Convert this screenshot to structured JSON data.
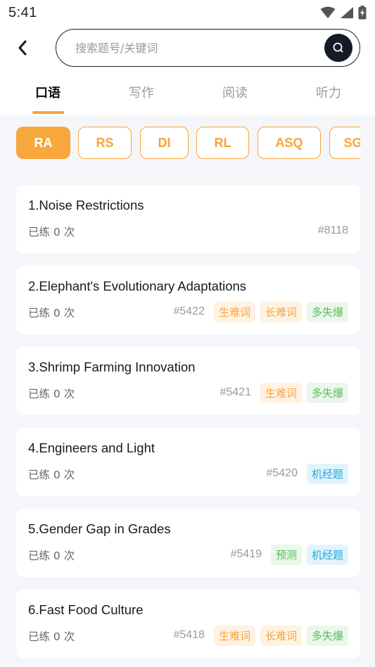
{
  "status_bar": {
    "time": "5:41"
  },
  "search": {
    "placeholder": "搜索题号/关键词",
    "value": ""
  },
  "tabs": [
    {
      "label": "口语",
      "active": true
    },
    {
      "label": "写作",
      "active": false
    },
    {
      "label": "阅读",
      "active": false
    },
    {
      "label": "听力",
      "active": false
    }
  ],
  "chips": [
    {
      "label": "RA",
      "active": true
    },
    {
      "label": "RS",
      "active": false
    },
    {
      "label": "DI",
      "active": false
    },
    {
      "label": "RL",
      "active": false
    },
    {
      "label": "ASQ",
      "active": false
    },
    {
      "label": "SGD",
      "active": false
    }
  ],
  "questions": [
    {
      "title": "1.Noise Restrictions",
      "practiced": "已练 0 次",
      "id": "#8118",
      "tags": []
    },
    {
      "title": "2.Elephant's Evolutionary Adaptations",
      "practiced": "已练 0 次",
      "id": "#5422",
      "tags": [
        {
          "label": "生难词",
          "color": "orange"
        },
        {
          "label": "长难词",
          "color": "orange"
        },
        {
          "label": "多失爆",
          "color": "green"
        }
      ]
    },
    {
      "title": "3.Shrimp Farming Innovation",
      "practiced": "已练 0 次",
      "id": "#5421",
      "tags": [
        {
          "label": "生难词",
          "color": "orange"
        },
        {
          "label": "多失爆",
          "color": "green"
        }
      ]
    },
    {
      "title": "4.Engineers and Light",
      "practiced": "已练 0 次",
      "id": "#5420",
      "tags": [
        {
          "label": "机经题",
          "color": "blue"
        }
      ]
    },
    {
      "title": "5.Gender Gap in Grades",
      "practiced": "已练 0 次",
      "id": "#5419",
      "tags": [
        {
          "label": "预测",
          "color": "green"
        },
        {
          "label": "机经题",
          "color": "blue"
        }
      ]
    },
    {
      "title": "6.Fast Food Culture",
      "practiced": "已练 0 次",
      "id": "#5418",
      "tags": [
        {
          "label": "生难词",
          "color": "orange"
        },
        {
          "label": "长难词",
          "color": "orange"
        },
        {
          "label": "多失爆",
          "color": "green"
        }
      ]
    }
  ],
  "colors": {
    "accent": "#f5a53a",
    "tag_orange": "#f5a53a",
    "tag_green": "#5cbb5e",
    "tag_blue": "#2aa6d8",
    "search_button": "#141a26"
  },
  "icons": {
    "back": "chevron-left-icon",
    "search": "search-icon",
    "wifi": "wifi-icon",
    "signal": "signal-icon",
    "battery": "battery-charging-icon"
  }
}
